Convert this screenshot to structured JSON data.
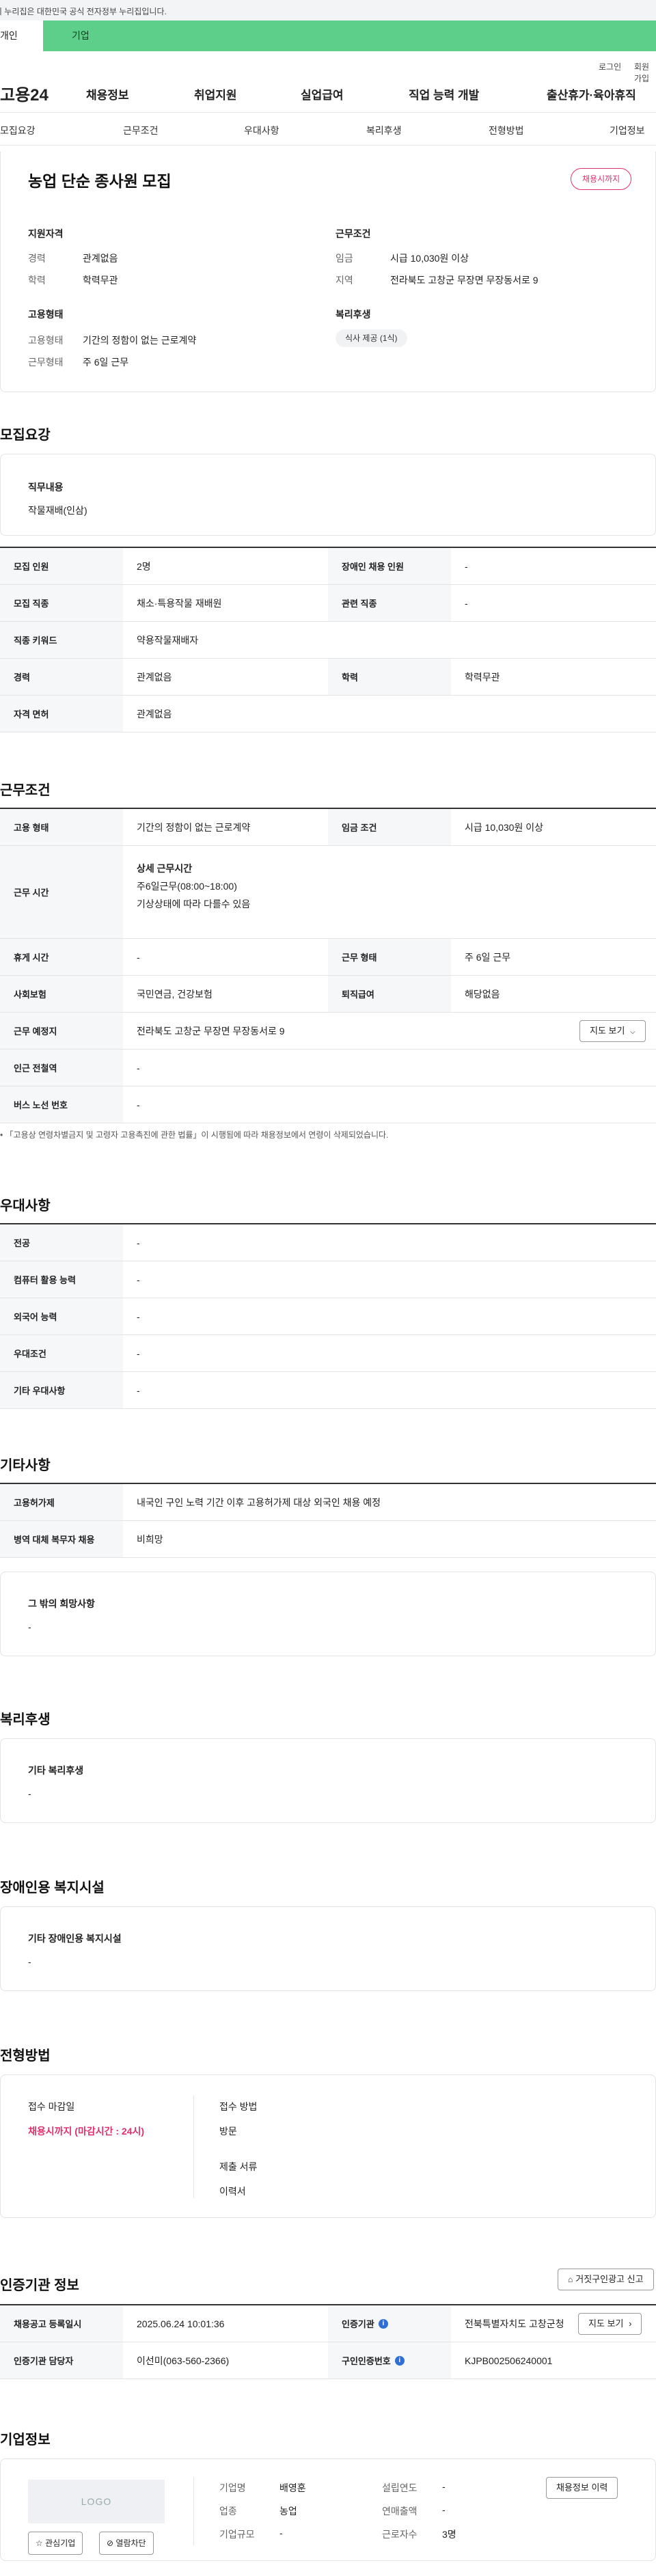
{
  "gov_banner": "이 누리집은 대한민국 공식 전자정부 누리집입니다.",
  "user_tabs": [
    "개인",
    "기업"
  ],
  "util": {
    "login": "로그인",
    "join": "회원가입"
  },
  "gnb": {
    "logo": "고용24",
    "menus": [
      "채용정보",
      "취업지원",
      "실업급여",
      "직업 능력 개발",
      "출산휴가·육아휴직"
    ]
  },
  "subnav": [
    "모집요강",
    "근무조건",
    "우대사항",
    "복리후생",
    "전형방법",
    "기업정보"
  ],
  "header": {
    "title": "농업 단순 종사원 모집",
    "badge": "채용시까지",
    "qual_title": "지원자격",
    "career_k": "경력",
    "career_v": "관계없음",
    "edu_k": "학력",
    "edu_v": "학력무관",
    "emp_title": "고용형태",
    "emptype_k": "고용형태",
    "emptype_v": "기간의 정함이 없는 근로계약",
    "workform_k": "근무형태",
    "workform_v": "주 6일 근무",
    "cond_title": "근무조건",
    "wage_k": "임금",
    "wage_v": "시급 10,030원 이상",
    "region_k": "지역",
    "region_v": "전라북도 고창군 무장면 무장동서로 9",
    "welfare_title": "복리후생",
    "welfare_chip": "식사 제공 (1식)"
  },
  "recruit": {
    "section_title": "모집요강",
    "duty_title": "직무내용",
    "duty_value": "작물재배(인삼)",
    "rows": [
      {
        "k1": "모집 인원",
        "v1": "2명",
        "k2": "장애인 채용 인원",
        "v2": "-"
      },
      {
        "k1": "모집 직종",
        "v1": "채소·특용작물 재배원",
        "k2": "관련 직종",
        "v2": "-"
      },
      {
        "k1": "직종 키워드",
        "v1": "약용작물재배자"
      },
      {
        "k1": "경력",
        "v1": "관계없음",
        "k2": "학력",
        "v2": "학력무관"
      },
      {
        "k1": "자격 면허",
        "v1": "관계없음"
      }
    ]
  },
  "work": {
    "section_title": "근무조건",
    "emptype_k": "고용 형태",
    "emptype_v": "기간의 정함이 없는 근로계약",
    "wage_k": "임금 조건",
    "wage_v": "시급 10,030원 이상",
    "hours_k": "근무 시간",
    "hours_title": "상세 근무시간",
    "hours_line1": "주6일근무(08:00~18:00)",
    "hours_line2": "기상상태에 따라 다를수 있음",
    "break_k": "휴게 시간",
    "break_v": "-",
    "workform_k": "근무 형태",
    "workform_v": "주 6일 근무",
    "insurance_k": "사회보험",
    "insurance_v": "국민연금, 건강보험",
    "retire_k": "퇴직급여",
    "retire_v": "해당없음",
    "place_k": "근무 예정지",
    "place_v": "전라북도 고창군 무장면 무장동서로 9",
    "map_btn": "지도 보기",
    "subway_k": "인근 전철역",
    "subway_v": "-",
    "bus_k": "버스 노선 번호",
    "bus_v": "-",
    "note": "「고용상 연령차별금지 및 고령자 고용촉진에 관한 법률」이 시행됨에 따라 채용정보에서 연령이 삭제되었습니다."
  },
  "prefer": {
    "section_title": "우대사항",
    "rows": [
      {
        "k": "전공",
        "v": "-"
      },
      {
        "k": "컴퓨터 활용 능력",
        "v": "-"
      },
      {
        "k": "외국어 능력",
        "v": "-"
      },
      {
        "k": "우대조건",
        "v": "-"
      },
      {
        "k": "기타 우대사항",
        "v": "-"
      }
    ]
  },
  "etc": {
    "section_title": "기타사항",
    "rows": [
      {
        "k": "고용허가제",
        "v": "내국인 구인 노력 기간 이후 고용허가제 대상 외국인 채용 예정"
      },
      {
        "k": "병역 대체 복무자 채용",
        "v": "비희망"
      }
    ],
    "other_title": "그 밖의 희망사항",
    "other_value": "-"
  },
  "welfare": {
    "section_title": "복리후생",
    "box_title": "기타 복리후생",
    "box_value": "-"
  },
  "disability": {
    "section_title": "장애인용 복지시설",
    "box_title": "기타 장애인용 복지시설",
    "box_value": "-"
  },
  "selection": {
    "section_title": "전형방법",
    "deadline_k": "접수 마감일",
    "deadline_v": "채용시까지 (마감시간 : 24시)",
    "method_k": "접수 방법",
    "method_v": "방문",
    "docs_k": "제출 서류",
    "docs_v": "이력서"
  },
  "cert": {
    "section_title": "인증기관 정보",
    "report_btn": "거짓구인광고 신고",
    "reg_k": "채용공고 등록일시",
    "reg_v": "2025.06.24 10:01:36",
    "org_k": "인증기관",
    "org_v": "전북특별자치도 고창군청",
    "map_btn": "지도 보기",
    "manager_k": "인증기관 담당자",
    "manager_v": "이선미(063-560-2366)",
    "id_k": "구인인증번호",
    "id_v": "KJPB002506240001"
  },
  "company": {
    "section_title": "기업정보",
    "logo": "LOGO",
    "fav_btn": "관심기업",
    "block_btn": "열람차단",
    "name_k": "기업명",
    "name_v": "배영훈",
    "industry_k": "업종",
    "industry_v": "농업",
    "size_k": "기업규모",
    "size_v": "-",
    "founded_k": "설립연도",
    "founded_v": "-",
    "revenue_k": "연매출액",
    "revenue_v": "-",
    "employees_k": "근로자수",
    "employees_v": "3명",
    "history_btn": "채용정보 이력"
  }
}
